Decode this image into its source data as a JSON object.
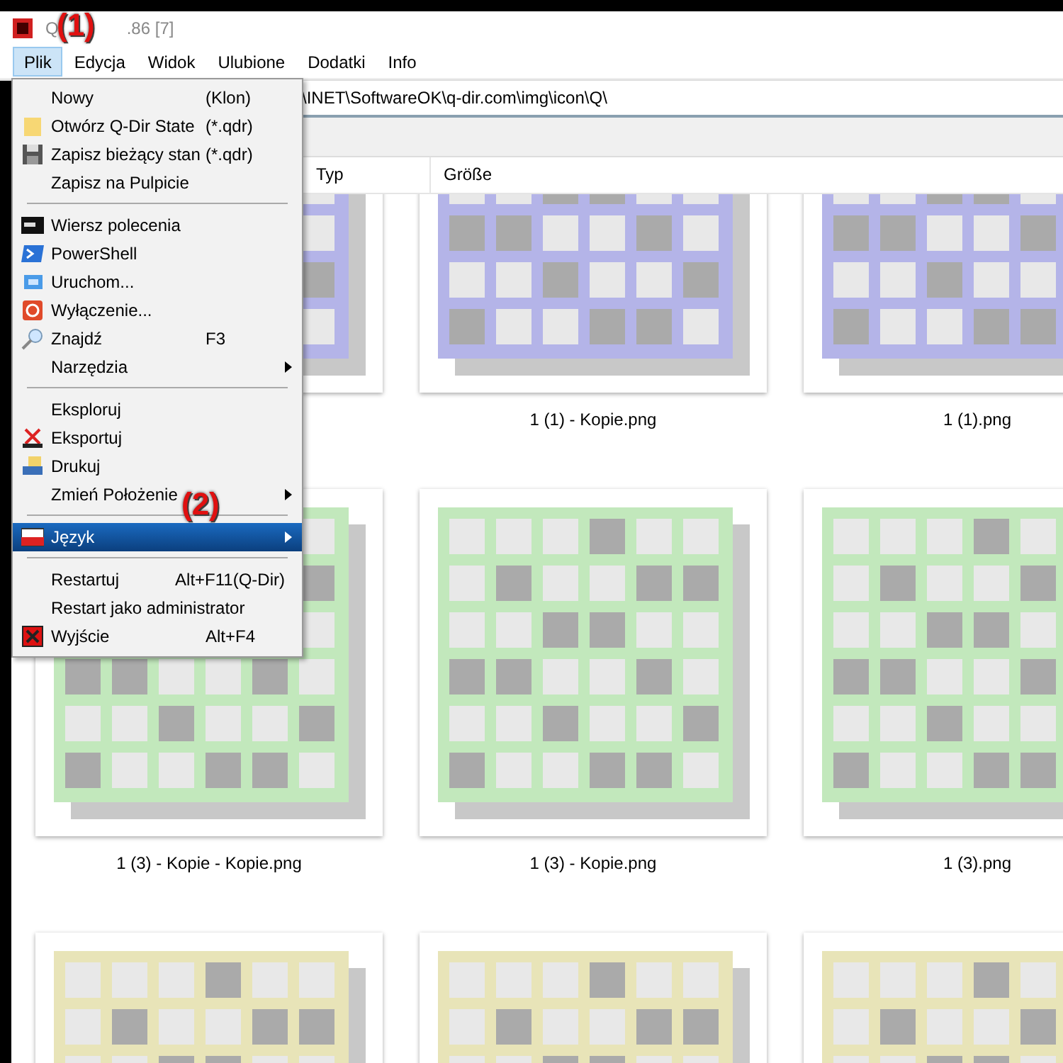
{
  "window": {
    "title_start": "Q",
    "title_end": ".86 [7]"
  },
  "menu_bar": [
    {
      "label": "Plik",
      "selected": true
    },
    {
      "label": "Edycja",
      "selected": false
    },
    {
      "label": "Widok",
      "selected": false
    },
    {
      "label": "Ulubione",
      "selected": false
    },
    {
      "label": "Dodatki",
      "selected": false
    },
    {
      "label": "Info",
      "selected": false
    }
  ],
  "address_bar": {
    "value": "\\INET\\SoftwareOK\\q-dir.com\\img\\icon\\Q\\"
  },
  "columns": [
    "Typ",
    "Größe"
  ],
  "file_menu": [
    {
      "kind": "item",
      "label": "Nowy",
      "shortcut": "(Klon)",
      "selected": false,
      "submenu": false
    },
    {
      "kind": "item",
      "label": "Otwórz Q-Dir State",
      "shortcut": "(*.qdr)",
      "selected": false,
      "submenu": false
    },
    {
      "kind": "item",
      "label": "Zapisz bieżący stan",
      "shortcut": "(*.qdr)",
      "selected": false,
      "submenu": false
    },
    {
      "kind": "item",
      "label": "Zapisz na Pulpicie",
      "selected": false,
      "submenu": false
    },
    {
      "kind": "separator"
    },
    {
      "kind": "item",
      "label": "Wiersz polecenia",
      "selected": false,
      "submenu": false
    },
    {
      "kind": "item",
      "label": "PowerShell",
      "selected": false,
      "submenu": false
    },
    {
      "kind": "item",
      "label": "Uruchom...",
      "selected": false,
      "submenu": false
    },
    {
      "kind": "item",
      "label": "Wyłączenie...",
      "selected": false,
      "submenu": false
    },
    {
      "kind": "item",
      "label": "Znajdź",
      "shortcut": "F3",
      "selected": false,
      "submenu": false
    },
    {
      "kind": "item",
      "label": "Narzędzia",
      "selected": false,
      "submenu": true
    },
    {
      "kind": "separator"
    },
    {
      "kind": "item",
      "label": "Eksploruj",
      "selected": false,
      "submenu": false
    },
    {
      "kind": "item",
      "label": "Eksportuj",
      "selected": false,
      "submenu": false
    },
    {
      "kind": "item",
      "label": "Drukuj",
      "selected": false,
      "submenu": false
    },
    {
      "kind": "item",
      "label": "Zmień Położenie",
      "selected": false,
      "submenu": true
    },
    {
      "kind": "separator"
    },
    {
      "kind": "item",
      "label": "Język",
      "selected": true,
      "submenu": true
    },
    {
      "kind": "separator"
    },
    {
      "kind": "item",
      "label": "Restartuj",
      "shortcut": "Alt+F11(Q-Dir)",
      "selected": false,
      "submenu": false
    },
    {
      "kind": "item",
      "label": "Restart jako administrator",
      "selected": false,
      "submenu": false
    },
    {
      "kind": "item",
      "label": "Wyjście",
      "shortcut": "Alt+F4",
      "selected": false,
      "submenu": false
    }
  ],
  "thumbnails": [
    {
      "color": "#b4b4e8"
    },
    {
      "name": "1 (1) - Kopie.png",
      "color": "#b4b4e8"
    },
    {
      "name": "1 (1).png",
      "color": "#b4b4e8"
    },
    {
      "name": "1 (3) - Kopie - Kopie.png",
      "color": "#c2e8bc"
    },
    {
      "name": "1 (3) - Kopie.png",
      "color": "#c2e8bc"
    },
    {
      "name": "1 (3).png",
      "color": "#c2e8bc"
    },
    {
      "color": "#e8e4b8"
    },
    {
      "color": "#e8e4b8"
    },
    {
      "color": "#e8e4b8"
    }
  ],
  "annotations": [
    "(1)",
    "(2)"
  ]
}
